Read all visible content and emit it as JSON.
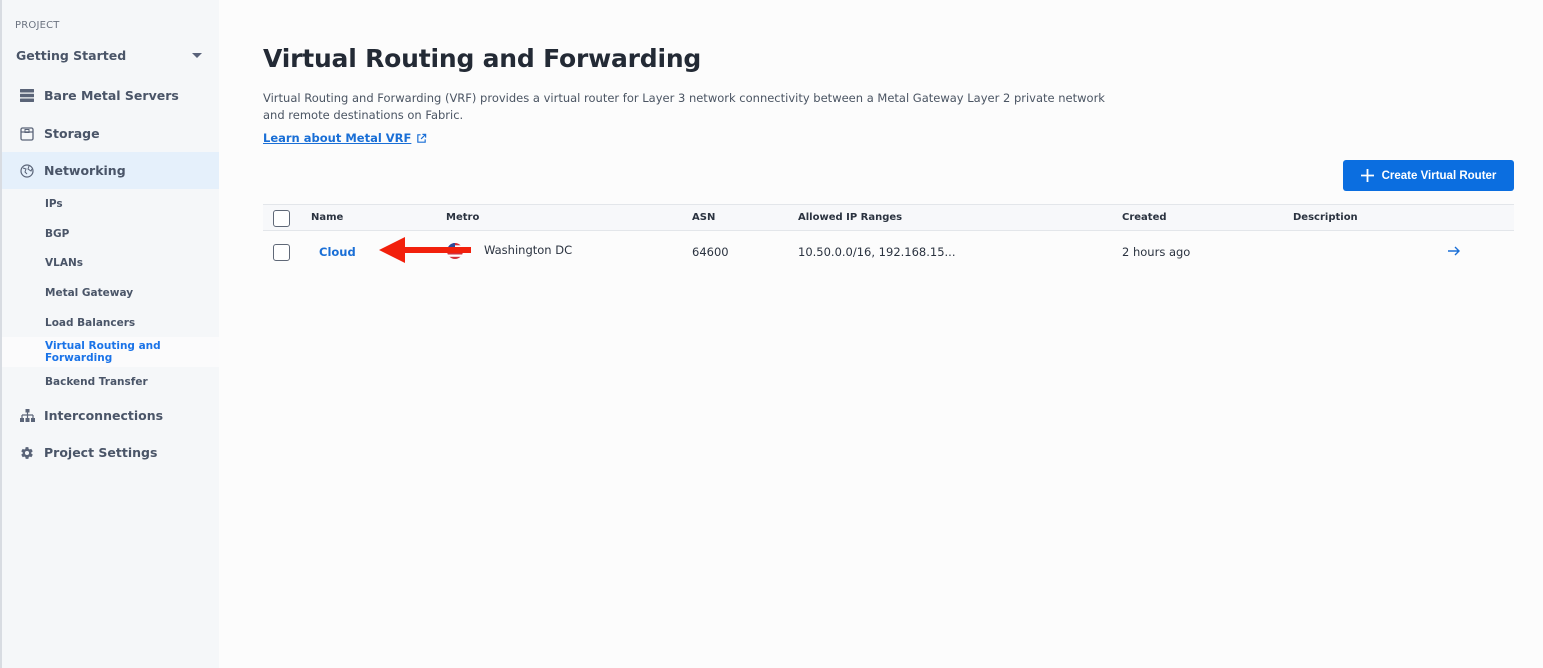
{
  "sidebar": {
    "project_label": "PROJECT",
    "project_name": "Getting Started",
    "items": [
      {
        "label": "Bare Metal Servers",
        "icon": "server-icon"
      },
      {
        "label": "Storage",
        "icon": "storage-icon"
      },
      {
        "label": "Networking",
        "icon": "globe-icon",
        "active": true
      },
      {
        "label": "Interconnections",
        "icon": "network-tree-icon"
      },
      {
        "label": "Project Settings",
        "icon": "gear-icon"
      }
    ],
    "sub_items": [
      {
        "label": "IPs"
      },
      {
        "label": "BGP"
      },
      {
        "label": "VLANs"
      },
      {
        "label": "Metal Gateway"
      },
      {
        "label": "Load Balancers"
      },
      {
        "label": "Virtual Routing and Forwarding",
        "active": true
      },
      {
        "label": "Backend Transfer"
      }
    ]
  },
  "main": {
    "title": "Virtual Routing and Forwarding",
    "description": "Virtual Routing and Forwarding (VRF) provides a virtual router for Layer 3 network connectivity between a Metal Gateway Layer 2 private network and remote destinations on Fabric.",
    "learn_link": "Learn about Metal VRF",
    "create_button": "Create Virtual Router",
    "table": {
      "headers": [
        "Name",
        "Metro",
        "ASN",
        "Allowed IP Ranges",
        "Created",
        "Description"
      ],
      "rows": [
        {
          "name": "Cloud",
          "metro": "Washington DC",
          "metro_flag": "us-flag-icon",
          "asn": "64600",
          "allowed_ip_ranges": "10.50.0.0/16, 192.168.15...",
          "created": "2 hours ago",
          "description": ""
        }
      ]
    }
  },
  "colors": {
    "accent": "#0b6ee0",
    "link": "#1a6fd6",
    "annotation_arrow": "#f2200c",
    "active_nav_bg": "#e5f0fb"
  }
}
